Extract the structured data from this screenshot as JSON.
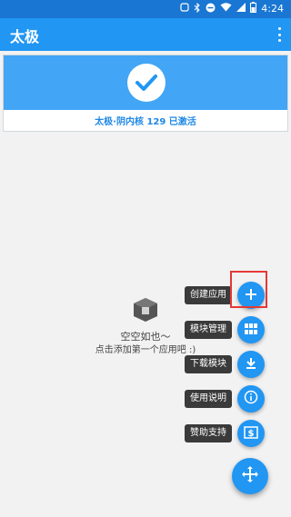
{
  "status_bar": {
    "time": "4:24"
  },
  "app_bar": {
    "title": "太极"
  },
  "card": {
    "status_text": "太极·阴内核 129 已激活"
  },
  "empty_state": {
    "title": "空空如也～",
    "subtitle": "点击添加第一个应用吧 :)"
  },
  "fab_menu": {
    "items": [
      {
        "label": "创建应用",
        "icon": "plus-icon"
      },
      {
        "label": "模块管理",
        "icon": "grid-icon"
      },
      {
        "label": "下载模块",
        "icon": "download-icon"
      },
      {
        "label": "使用说明",
        "icon": "info-icon"
      },
      {
        "label": "赞助支持",
        "icon": "dollar-icon"
      }
    ],
    "main_icon": "move-arrows-icon"
  },
  "colors": {
    "primary": "#2196f3",
    "status_bar": "#1976d2",
    "card_blue": "#42a5f5",
    "highlight": "#e53935"
  }
}
